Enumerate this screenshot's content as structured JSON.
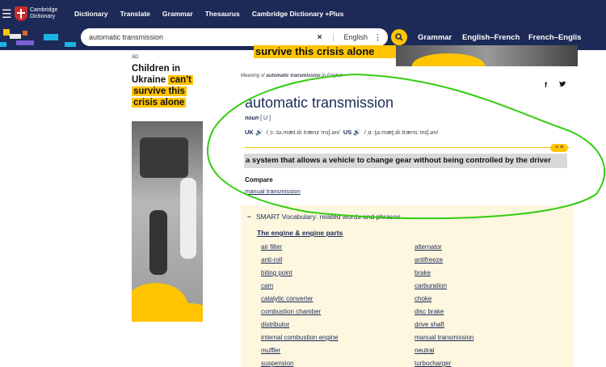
{
  "nav": {
    "logo_line1": "Cambridge",
    "logo_line2": "Dictionary",
    "links": [
      "Dictionary",
      "Translate",
      "Grammar",
      "Thesaurus",
      "Cambridge Dictionary +Plus"
    ]
  },
  "search": {
    "query": "automatic transmission",
    "clear": "×",
    "language": "English",
    "more": "⋮",
    "links": [
      "Grammar",
      "English–French",
      "French–Englis"
    ]
  },
  "ad": {
    "label": "AD",
    "l1": "Children in",
    "l2a": "Ukraine",
    "l2b": "can't",
    "l3": "survive this",
    "l4": "crisis alone"
  },
  "top_banner": "survive this crisis alone",
  "entry": {
    "meaning_pre": "Meaning of",
    "meaning_term": "automatic transmission",
    "meaning_post": "in English",
    "facebook": "f",
    "twitter": "🐦",
    "headword": "automatic transmission",
    "pos": "noun",
    "gram": "[ U ]",
    "uk_label": "UK",
    "uk_ipa": "/ˌɔː.tə.mæt.ɪk trænzˈmɪʃ.ən/",
    "us_label": "US",
    "us_ipa": "/ˌɑː.t̬ə.mæt̬.ɪk trænsˈmɪʃ.ən/",
    "plus_label": "+ ≡",
    "definition": "a system that allows a vehicle to change gear without being controlled by the driver",
    "compare_label": "Compare",
    "compare_link": "manual transmission"
  },
  "smart": {
    "toggle": "−",
    "title": "SMART Vocabulary: related words and phrases",
    "subtitle": "The engine & engine parts",
    "left": [
      "air filter",
      "anti-roll",
      "biting point",
      "cam",
      "catalytic converter",
      "combustion chamber",
      "distributor",
      "internal combustion engine",
      "muffler",
      "suspension"
    ],
    "right": [
      "alternator",
      "antifreeze",
      "brake",
      "carburation",
      "choke",
      "disc brake",
      "drive shaft",
      "manual transmission",
      "neutral",
      "turbocharger"
    ]
  },
  "colors": {
    "navy": "#1d2a57",
    "yellow": "#fec400",
    "annotation": "#33cc11"
  }
}
